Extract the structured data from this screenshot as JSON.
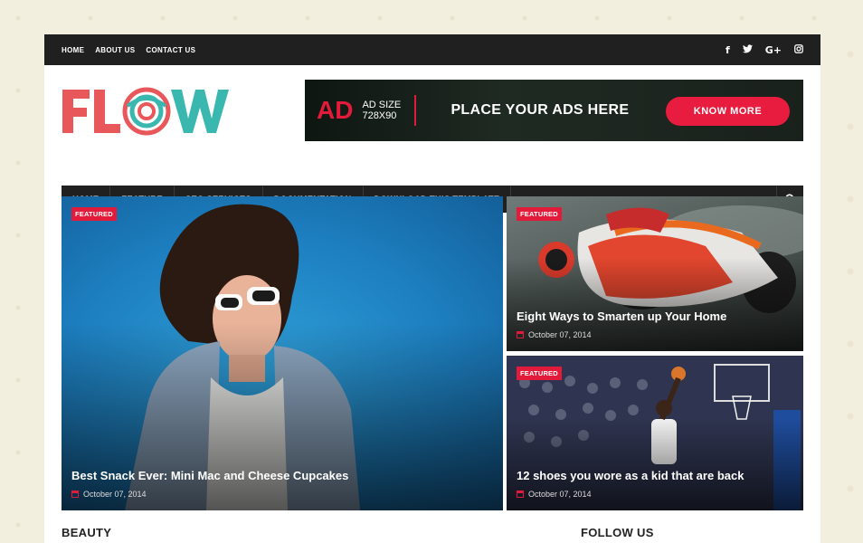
{
  "topbar": {
    "links": [
      "HOME",
      "ABOUT US",
      "CONTACT US"
    ],
    "social_icons": [
      "facebook-icon",
      "twitter-icon",
      "google-plus-icon",
      "instagram-icon"
    ]
  },
  "logo": {
    "text": "FLOW",
    "colors": {
      "primary": "#e8585b",
      "accent": "#3ab8b0"
    }
  },
  "ad": {
    "big": "AD",
    "size_line1": "AD SIZE",
    "size_line2": "728X90",
    "headline": "PLACE YOUR ADS HERE",
    "button": "KNOW MORE"
  },
  "nav": {
    "items": [
      "HOME",
      "FEATURE",
      "SEO SERVICES",
      "DOCUMENTATION",
      "DOWNLOAD THIS TEMPLATE"
    ]
  },
  "featured": {
    "big": {
      "badge": "FEATURED",
      "title": "Best Snack Ever: Mini Mac and Cheese Cupcakes",
      "date": "October 07, 2014"
    },
    "m1": {
      "badge": "FEATURED",
      "title": "Eight Ways to Smarten up Your Home",
      "date": "October 07, 2014"
    },
    "m2": {
      "badge": "FEATURED",
      "title": "12 shoes you wore as a kid that are back",
      "date": "October 07, 2014"
    }
  },
  "sections": {
    "left": "BEAUTY",
    "right": "FOLLOW US"
  },
  "colors": {
    "accent": "#e31b3b",
    "dark": "#202020"
  }
}
